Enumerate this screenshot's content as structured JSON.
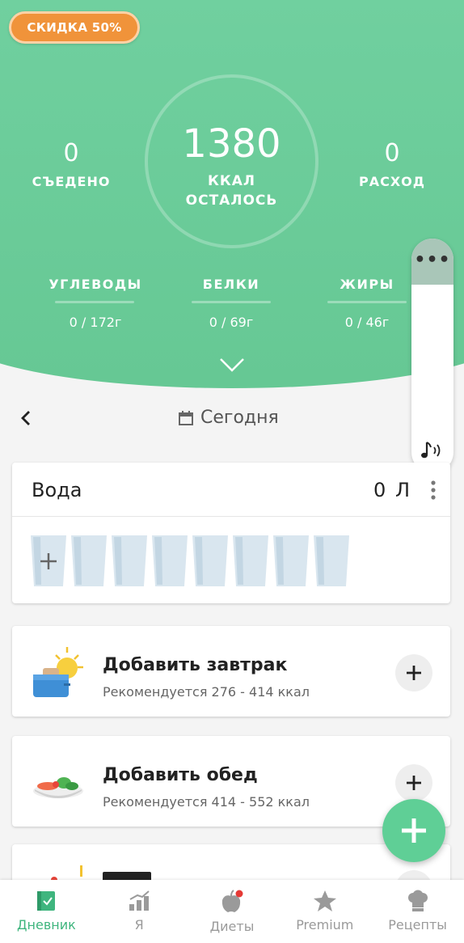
{
  "hero": {
    "discount": "СКИДКА 50%",
    "eaten": {
      "value": "0",
      "label": "СЪЕДЕНО"
    },
    "remaining": {
      "value": "1380",
      "unit": "ККАЛ",
      "label": "ОСТАЛОСЬ"
    },
    "burned": {
      "value": "0",
      "label": "РАСХОД"
    },
    "macros": [
      {
        "label": "УГЛЕВОДЫ",
        "value": "0 / 172г"
      },
      {
        "label": "БЕЛКИ",
        "value": "0 / 69г"
      },
      {
        "label": "ЖИРЫ",
        "value": "0 / 46г"
      }
    ]
  },
  "side_panel": {
    "more": "•••"
  },
  "date": {
    "label": "Сегодня"
  },
  "water": {
    "title": "Вода",
    "amount": "0 Л",
    "glasses": 8
  },
  "meals": [
    {
      "title": "Добавить завтрак",
      "subtitle": "Рекомендуется 276 - 414 ккал"
    },
    {
      "title": "Добавить обед",
      "subtitle": "Рекомендуется 414 - 552 ккал"
    }
  ],
  "nav": [
    {
      "label": "Дневник",
      "icon": "diary-icon",
      "active": true
    },
    {
      "label": "Я",
      "icon": "progress-icon"
    },
    {
      "label": "Диеты",
      "icon": "apple-icon"
    },
    {
      "label": "Premium",
      "icon": "star-icon"
    },
    {
      "label": "Рецепты",
      "icon": "chef-hat-icon"
    }
  ],
  "colors": {
    "accent": "#5fcf96",
    "discount": "#f0933a"
  }
}
